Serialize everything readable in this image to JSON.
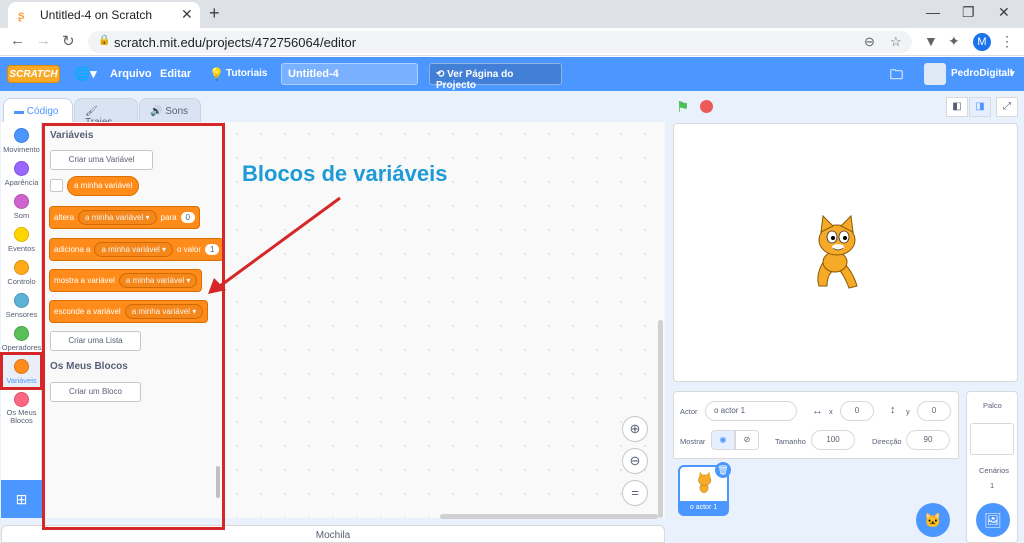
{
  "browser": {
    "tab_title": "Untitled-4 on Scratch",
    "url": "scratch.mit.edu/projects/472756064/editor",
    "avatar_letter": "M"
  },
  "menubar": {
    "logo": "SCRATCH",
    "file": "Arquivo",
    "edit": "Editar",
    "tutorials": "Tutoriais",
    "project_name": "Untitled-4",
    "view_page": "Ver Página do Projecto",
    "username": "PedroDigitalI"
  },
  "editor_tabs": {
    "code": "Código",
    "costumes": "Trajes",
    "sounds": "Sons"
  },
  "categories": [
    {
      "label": "Movimento",
      "color": "#4c97ff"
    },
    {
      "label": "Aparência",
      "color": "#9966ff"
    },
    {
      "label": "Som",
      "color": "#cf63cf"
    },
    {
      "label": "Eventos",
      "color": "#ffd500"
    },
    {
      "label": "Controlo",
      "color": "#ffab19"
    },
    {
      "label": "Sensores",
      "color": "#5cb1d6"
    },
    {
      "label": "Operadores",
      "color": "#59c059"
    },
    {
      "label": "Variáveis",
      "color": "#ff8c1a"
    },
    {
      "label": "Os Meus Blocos",
      "color": "#ff6680"
    }
  ],
  "palette": {
    "variables_title": "Variáveis",
    "make_variable": "Criar uma Variável",
    "my_variable": "a minha variável",
    "set_label": "altera",
    "set_to": "para",
    "set_value": "0",
    "change_label": "adiciona a",
    "change_by": "o valor",
    "change_value": "1",
    "show_label": "mostra a variável",
    "hide_label": "esconde a variável",
    "make_list": "Criar uma Lista",
    "my_blocks_title": "Os Meus Blocos",
    "make_block": "Criar um Bloco"
  },
  "annotation": "Blocos de variáveis",
  "backpack": "Mochila",
  "sprite_info": {
    "actor_label": "Actor",
    "actor_name": "o actor 1",
    "x_label": "x",
    "x_value": "0",
    "y_label": "y",
    "y_value": "0",
    "show_label": "Mostrar",
    "size_label": "Tamanho",
    "size_value": "100",
    "direction_label": "Direcção",
    "direction_value": "90",
    "sprite_card_name": "o actor 1"
  },
  "stage_panel": {
    "title": "Palco",
    "backdrops_label": "Cenários",
    "backdrops_count": "1"
  }
}
